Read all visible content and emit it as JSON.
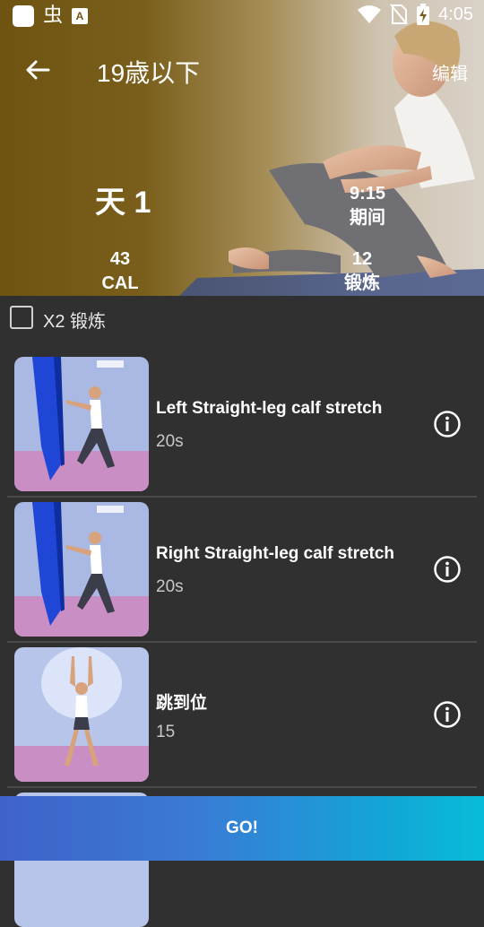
{
  "status_bar": {
    "time": "4:05",
    "icons": [
      "app-icon",
      "bug-icon",
      "a-icon",
      "wifi-icon",
      "no-sim-icon",
      "battery-charging-icon"
    ]
  },
  "toolbar": {
    "title": "19歳以下",
    "edit_label": "编辑"
  },
  "hero": {
    "day_label": "天 1",
    "duration_value": "9:15",
    "duration_label": "期间",
    "calories_value": "43",
    "calories_label": "CAL",
    "exercises_value": "12",
    "exercises_label": "锻炼"
  },
  "x2": {
    "label": "X2 锻炼",
    "checked": false
  },
  "exercises": [
    {
      "name": "Left Straight-leg calf stretch",
      "duration": "20s"
    },
    {
      "name": "Right Straight-leg calf stretch",
      "duration": "20s"
    },
    {
      "name": "跳到位",
      "duration": "15"
    }
  ],
  "go_button": {
    "label": "GO!"
  },
  "colors": {
    "go_start": "#3f62c9",
    "go_end": "#08bcd9",
    "background": "#303030"
  }
}
